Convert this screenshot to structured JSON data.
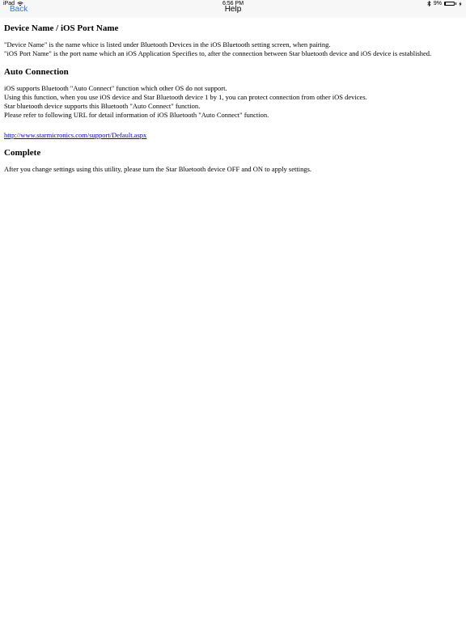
{
  "status_bar": {
    "device": "iPad",
    "time": "6:56 PM",
    "battery_text": "9%",
    "battery_level": 0.09
  },
  "nav": {
    "back_label": "Back",
    "title": "Help",
    "accent_color": "#1d7cf2"
  },
  "sections": {
    "device_name": {
      "heading": "Device Name / iOS Port Name",
      "lines": [
        "\"Device Name\" is the name whice is listed under Bluetooth Devices in the iOS Bluetooth setting screen, when pairing.",
        "\"iOS Port Name\" is the port name which an iOS Application Specifies to, after the connection between Star bluetooth device and iOS device is established."
      ]
    },
    "auto_connection": {
      "heading": "Auto Connection",
      "lines": [
        "iOS supports Bluetooth \"Auto Connect\" function which other OS do not support.",
        "Using this function, when you use iOS device and Star Bluetooth device 1 by 1, you can protect connection from other iOS devices.",
        "Star bluetooth device supports this Bluetooth \"Auto Connect\" function.",
        "Please refer to following URL for detail information of iOS Bluetooth \"Auto Connect\" function."
      ],
      "link": "http://www.starmicronics.com/support/Default.aspx"
    },
    "complete": {
      "heading": "Complete",
      "lines": [
        "After you change settings using this utility, please turn the Star Bluetooth device OFF and ON to apply settings."
      ]
    }
  }
}
